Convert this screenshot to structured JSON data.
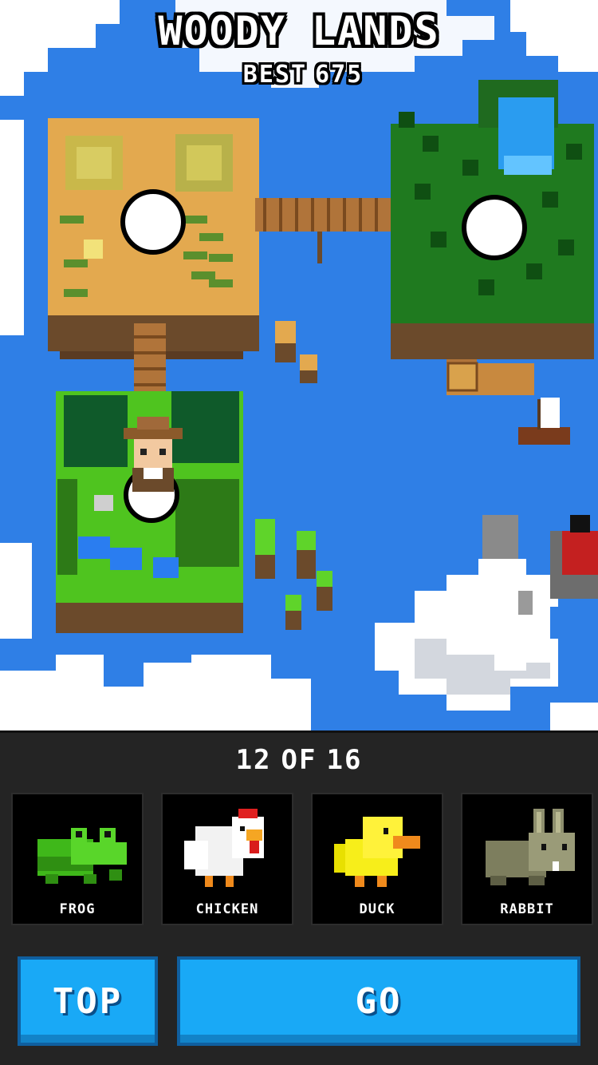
{
  "header": {
    "title": "WOODY LANDS",
    "best_label": "BEST",
    "best_score": "675"
  },
  "progress": {
    "unlocked": "12",
    "of_label": "OF",
    "total": "16"
  },
  "characters": [
    {
      "label": "FROG",
      "icon": "frog-icon"
    },
    {
      "label": "CHICKEN",
      "icon": "chicken-icon"
    },
    {
      "label": "DUCK",
      "icon": "duck-icon"
    },
    {
      "label": "RABBIT",
      "icon": "rabbit-icon"
    }
  ],
  "buttons": {
    "top_label": "TOP",
    "go_label": "GO"
  },
  "colors": {
    "sea": "#2f7fe6",
    "button": "#19a9f6",
    "panel": "#242424"
  }
}
